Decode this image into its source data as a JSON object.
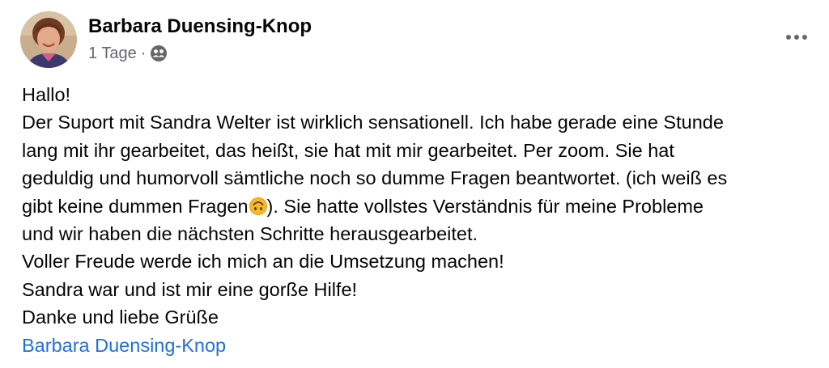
{
  "post": {
    "author": "Barbara Duensing-Knop",
    "time": "1 Tage",
    "separator": "·",
    "audience_icon": "friends-icon",
    "more_icon": "more-options-icon",
    "lines": [
      "Hallo!",
      "Der Suport mit Sandra Welter ist wirklich sensationell. Ich habe gerade eine Stunde",
      "lang mit ihr gearbeitet, das heißt, sie hat mit mir gearbeitet. Per zoom. Sie hat",
      "geduldig und humorvoll sämtliche noch so dumme Fragen beantwortet. (ich weiß es",
      "gibt keine dummen Fragen",
      "). Sie hatte vollstes Verständnis für meine Probleme",
      "und wir haben die nächsten Schritte herausgearbeitet.",
      "Voller Freude werde ich mich an die Umsetzung machen!",
      "Sandra war und ist mir eine gorße Hilfe!",
      "Danke und liebe Grüße"
    ],
    "emoji": "upside-down-face-emoji",
    "signature_link": "Barbara Duensing-Knop"
  },
  "colors": {
    "text": "#050505",
    "secondary": "#65676b",
    "link": "#216fdb"
  }
}
